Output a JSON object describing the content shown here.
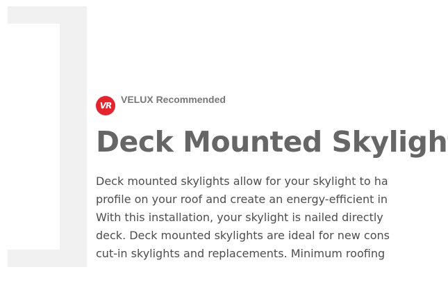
{
  "badge": {
    "icon_text": "VR",
    "label": "VELUX Recommended"
  },
  "title": "Deck Mounted Skylights",
  "description_lines": [
    "Deck mounted skylights allow for your skylight to ha",
    "profile on your roof and create an energy-efficient in",
    "With this installation, your skylight is nailed directly",
    "deck. Deck mounted skylights are ideal for new cons",
    "cut-in skylights and replacements. Minimum roofing"
  ],
  "colors": {
    "badge_red": "#e3262d",
    "title_gray": "#666666",
    "text_gray": "#4d4d4d",
    "bracket_gray": "#f1f1f1"
  }
}
